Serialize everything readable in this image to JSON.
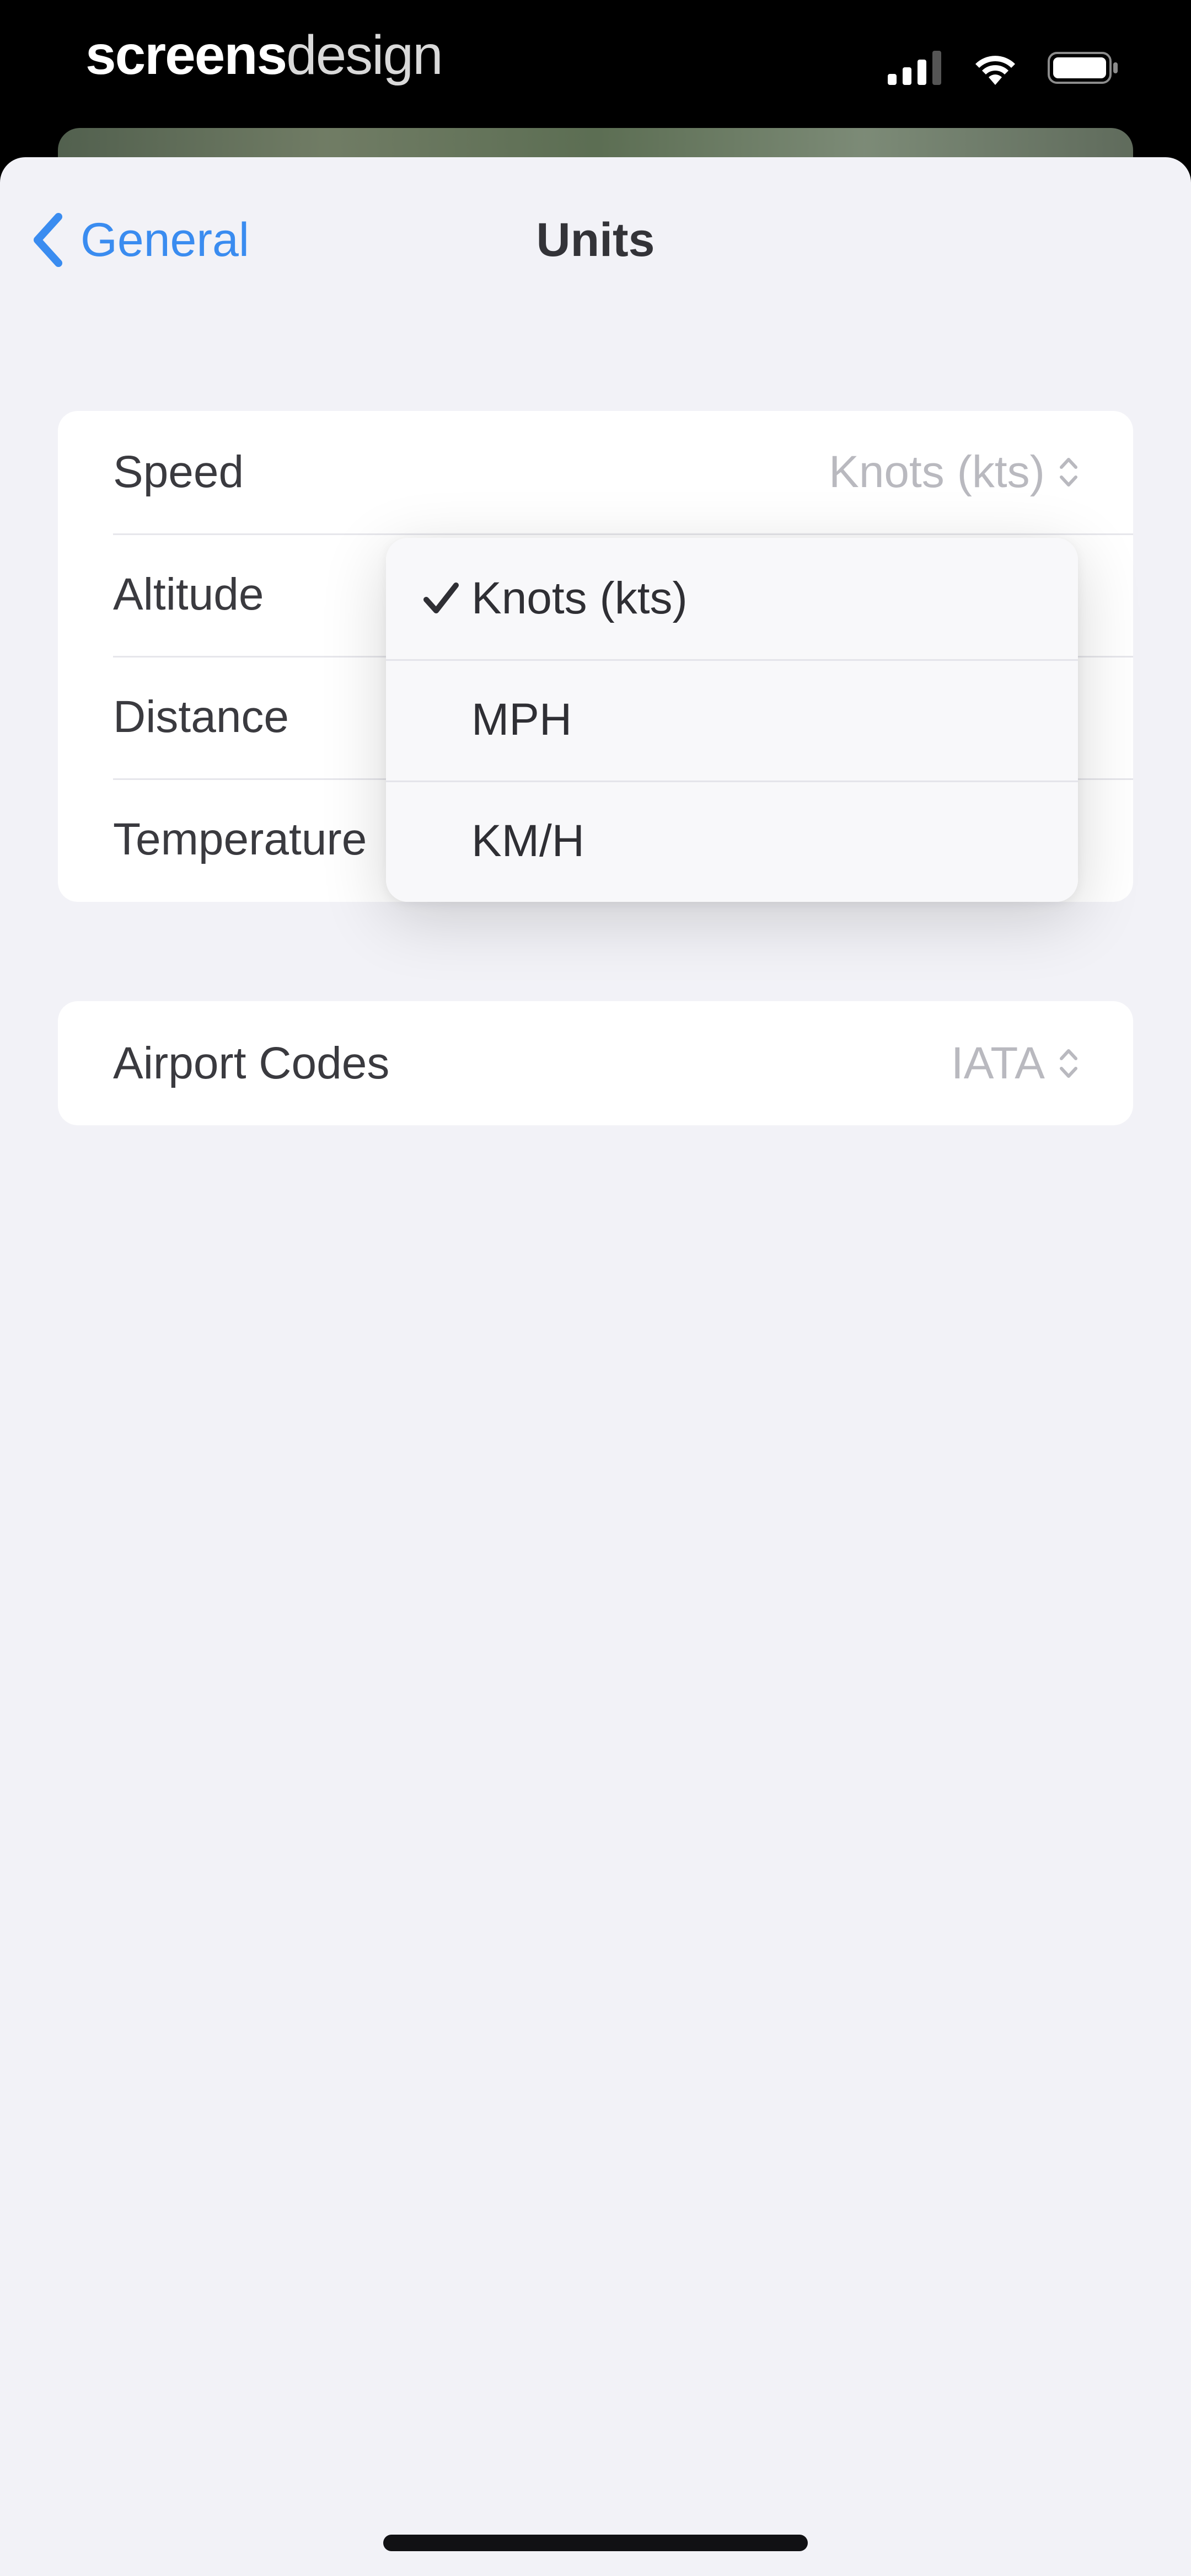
{
  "status_bar": {
    "brand_bold": "screens",
    "brand_light": "design",
    "icons": [
      "cellular-signal-icon",
      "wifi-icon",
      "battery-icon"
    ]
  },
  "nav": {
    "back_label": "General",
    "title": "Units"
  },
  "units_group": {
    "rows": [
      {
        "label": "Speed",
        "value": "Knots (kts)"
      },
      {
        "label": "Altitude"
      },
      {
        "label": "Distance"
      },
      {
        "label": "Temperature"
      }
    ]
  },
  "speed_menu": {
    "selected": "Knots (kts)",
    "options": [
      "Knots (kts)",
      "MPH",
      "KM/H"
    ]
  },
  "airport_group": {
    "rows": [
      {
        "label": "Airport Codes",
        "value": "IATA"
      }
    ]
  },
  "colors": {
    "accent": "#3a8cf0",
    "background": "#f2f2f7",
    "cell": "#ffffff",
    "secondary_text": "#b9b9bf"
  }
}
